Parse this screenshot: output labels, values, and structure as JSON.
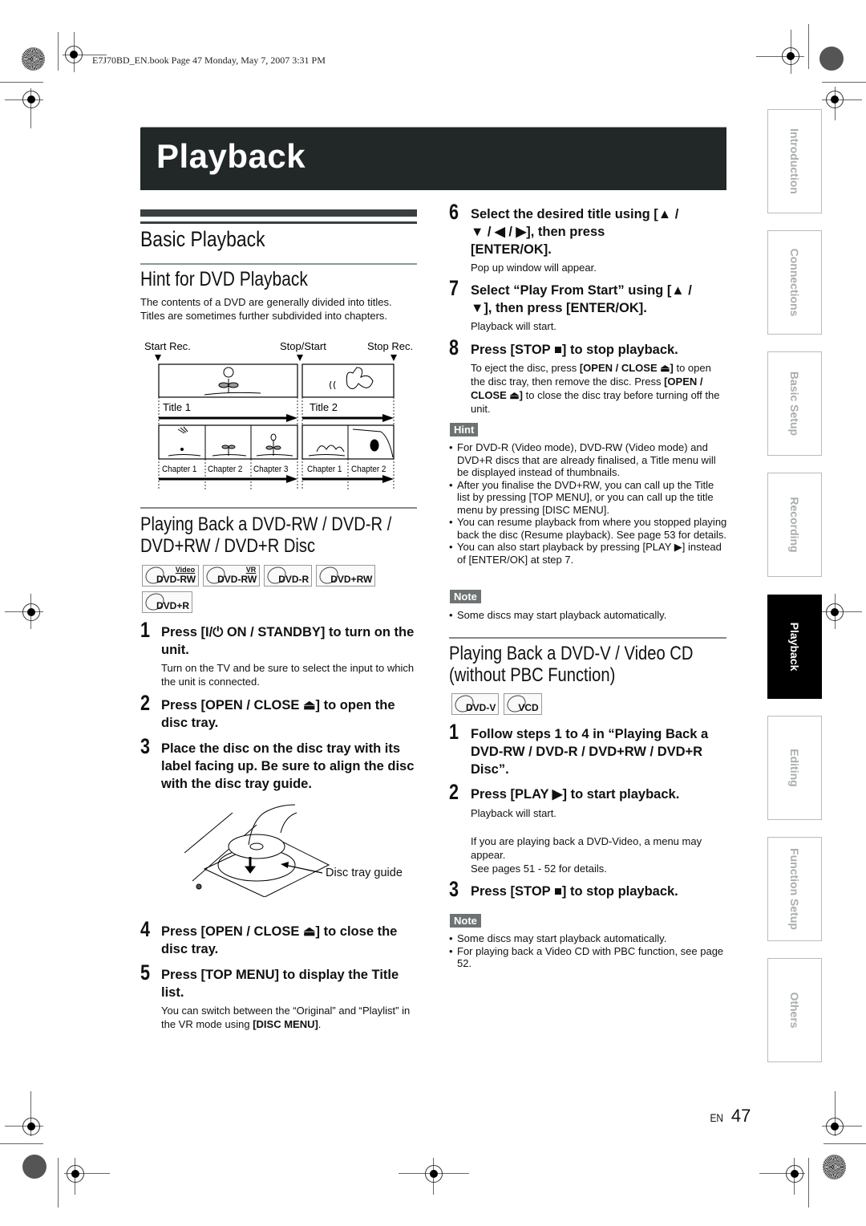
{
  "header": {
    "file_info": "E7J70BD_EN.book  Page 47  Monday, May 7, 2007  3:31 PM"
  },
  "page_title": "Playback",
  "left": {
    "section_title": "Basic Playback",
    "hint_title": "Hint for DVD Playback",
    "hint_body": "The contents of a DVD are generally divided into titles. Titles are sometimes further subdivided into chapters.",
    "diagram": {
      "markers": [
        "Start Rec.",
        "Stop/Start",
        "Stop Rec."
      ],
      "titles": [
        "Title 1",
        "Title 2"
      ],
      "chapters_title1": [
        "Chapter 1",
        "Chapter 2",
        "Chapter 3"
      ],
      "chapters_title2": [
        "Chapter 1",
        "Chapter 2"
      ]
    },
    "playing_back_title_line1": "Playing Back a DVD-RW / DVD-R /",
    "playing_back_title_line2": "DVD+RW / DVD+R Disc",
    "discs": [
      {
        "label": "DVD-RW",
        "sup": "Video"
      },
      {
        "label": "DVD-RW",
        "sup": "VR"
      },
      {
        "label": "DVD-R",
        "sup": ""
      },
      {
        "label": "DVD+RW",
        "sup": ""
      },
      {
        "label": "DVD+R",
        "sup": ""
      }
    ],
    "steps": [
      {
        "num": "1",
        "text": "Press [I/⏻ ON / STANDBY] to turn on the unit.",
        "sub": "Turn on the TV and be sure to select the input to which the unit is connected."
      },
      {
        "num": "2",
        "text": "Press [OPEN / CLOSE ⏏] to open the disc tray.",
        "sub": ""
      },
      {
        "num": "3",
        "text": "Place the disc on the disc tray with its label facing up. Be sure to align the disc with the disc tray guide.",
        "sub": ""
      },
      {
        "num": "4",
        "text": "Press [OPEN / CLOSE ⏏] to close the disc tray.",
        "sub": ""
      },
      {
        "num": "5",
        "text": "Press [TOP MENU] to display the Title list.",
        "sub_pre": "You can switch between the “Original” and “Playlist” in the VR mode using ",
        "sub_bold": "[DISC MENU]",
        "sub_post": "."
      }
    ],
    "disc_tray_guide": "Disc tray guide"
  },
  "right": {
    "steps": [
      {
        "num": "6",
        "text": "Select the desired title using [▲ / ▼ / ◀ / ▶], then press [ENTER/OK].",
        "sub": "Pop up window will appear."
      },
      {
        "num": "7",
        "text": "Select “Play From Start” using [▲ / ▼], then press [ENTER/OK].",
        "sub": "Playback will start."
      },
      {
        "num": "8",
        "text": "Press [STOP ■] to stop playback.",
        "sub_parts": [
          "To eject the disc, press ",
          "[OPEN / CLOSE ⏏]",
          " to open the disc tray, then remove the disc. Press ",
          "[OPEN / CLOSE ⏏]",
          " to close the disc tray before turning off the unit."
        ]
      }
    ],
    "hint_label": "Hint",
    "hints": [
      "For DVD-R (Video mode), DVD-RW (Video mode) and DVD+R discs that are already finalised, a Title menu will be displayed instead of thumbnails.",
      "After you finalise the DVD+RW, you can call up the Title list by pressing [TOP MENU], or you can call up the title menu by pressing [DISC MENU].",
      "You can resume playback from where you stopped playing back the disc (Resume playback). See page 53 for details.",
      "You can also start playback by pressing [PLAY ▶] instead of [ENTER/OK] at step 7."
    ],
    "note_label": "Note",
    "note1": "Some discs may start playback automatically.",
    "vcd_title_line1": "Playing Back a DVD-V / Video CD",
    "vcd_title_line2": "(without PBC Function)",
    "vcd_discs": [
      {
        "label": "DVD-V"
      },
      {
        "label": "VCD"
      }
    ],
    "vcd_steps": [
      {
        "num": "1",
        "text": "Follow steps 1 to 4 in “Playing Back a DVD-RW / DVD-R / DVD+RW / DVD+R Disc”."
      },
      {
        "num": "2",
        "text": "Press [PLAY ▶] to start playback.",
        "sub1": "Playback will start.",
        "sub2": "If you are playing back a DVD-Video, a menu may appear.",
        "sub3": "See pages 51 - 52 for details."
      },
      {
        "num": "3",
        "text": "Press [STOP ■] to stop playback."
      }
    ],
    "note2_label": "Note",
    "notes2": [
      "Some discs may start playback automatically.",
      "For playing back a Video CD with PBC function, see page 52."
    ]
  },
  "side_tabs": [
    {
      "label": "Introduction",
      "active": false
    },
    {
      "label": "Connections",
      "active": false
    },
    {
      "label": "Basic Setup",
      "active": false
    },
    {
      "label": "Recording",
      "active": false
    },
    {
      "label": "Playback",
      "active": true
    },
    {
      "label": "Editing",
      "active": false
    },
    {
      "label": "Function Setup",
      "active": false
    },
    {
      "label": "Others",
      "active": false
    }
  ],
  "footer": {
    "lang": "EN",
    "page": "47"
  }
}
